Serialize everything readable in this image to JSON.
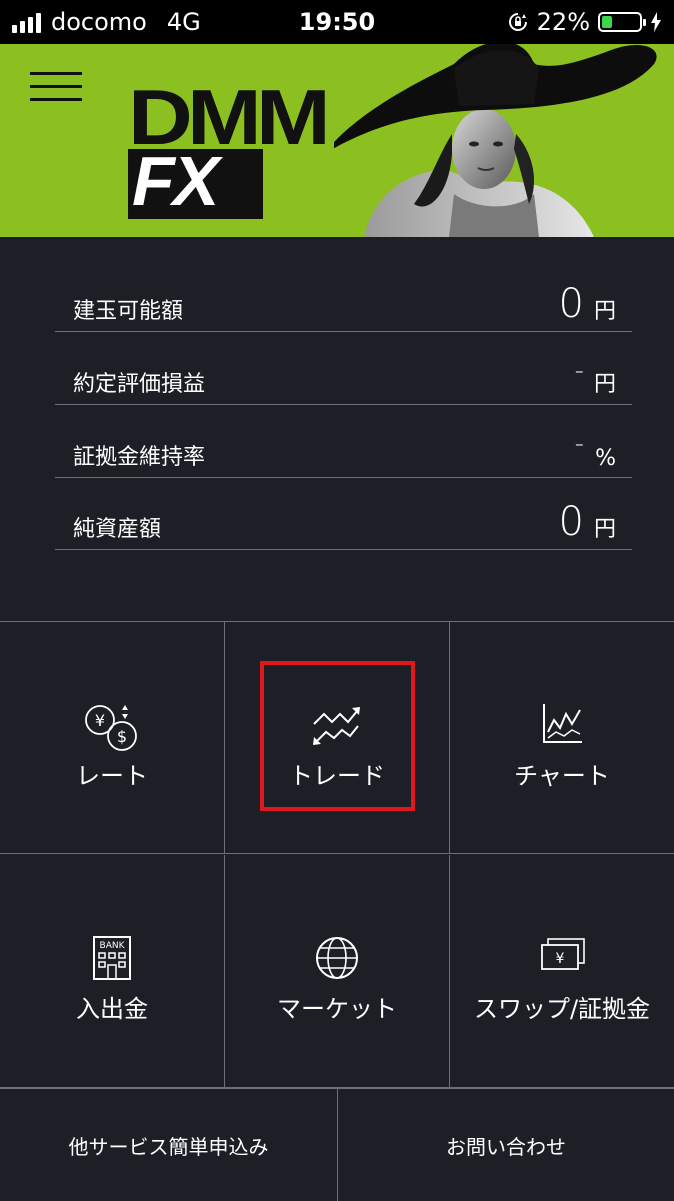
{
  "status_bar": {
    "carrier": "docomo",
    "network": "4G",
    "time": "19:50",
    "battery_percent": "22%"
  },
  "brand": {
    "logo_top": "DMM",
    "logo_bottom": "FX"
  },
  "summary": [
    {
      "label": "建玉可能額",
      "value": "0",
      "unit": "円"
    },
    {
      "label": "約定評価損益",
      "value": "-",
      "unit": "円"
    },
    {
      "label": "証拠金維持率",
      "value": "-",
      "unit": "%"
    },
    {
      "label": "純資産額",
      "value": "0",
      "unit": "円"
    }
  ],
  "menu": [
    {
      "label": "レート",
      "icon": "currency-exchange-icon"
    },
    {
      "label": "トレード",
      "icon": "trade-arrows-icon"
    },
    {
      "label": "チャート",
      "icon": "chart-icon"
    },
    {
      "label": "入出金",
      "icon": "bank-icon"
    },
    {
      "label": "マーケット",
      "icon": "globe-icon"
    },
    {
      "label": "スワップ/証拠金",
      "icon": "banknote-icon"
    }
  ],
  "bottom_links": [
    {
      "label": "他サービス簡単申込み"
    },
    {
      "label": "お問い合わせ"
    }
  ],
  "colors": {
    "banner_green": "#8cc021",
    "background": "#1d1f26",
    "highlight_red": "#e0171b",
    "battery_green": "#3cd64a"
  }
}
